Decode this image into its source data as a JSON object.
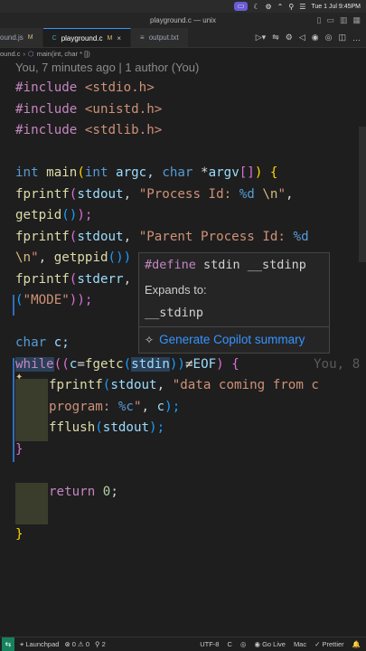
{
  "menubar": {
    "items": [
      "▭",
      "☾",
      "⚙",
      "⌃",
      "⚲",
      "☰"
    ],
    "datetime": "Tue 1 Jul  9:45PM"
  },
  "window": {
    "title": "playground.c — unix"
  },
  "tabs": [
    {
      "label": "ound.js",
      "modified": "M",
      "active": false
    },
    {
      "label": "playground.c",
      "modified": "M",
      "active": true,
      "close": "×"
    },
    {
      "label": "output.txt",
      "active": false
    }
  ],
  "breadcrumb": {
    "file": "ound.c",
    "sep": "›",
    "symbol": "main(int, char * [])"
  },
  "blame": "You, 7 minutes ago | 1 author (You)",
  "code": {
    "inc1": {
      "kw": "#include",
      "hdr": " <stdio.h>"
    },
    "inc2": {
      "kw": "#include",
      "hdr": " <unistd.h>"
    },
    "inc3": {
      "kw": "#include",
      "hdr": " <stdlib.h>"
    },
    "main": {
      "t1": "int",
      "name": " main",
      "p1": "(",
      "t2": "int",
      "a1": " argc, ",
      "t3": "char",
      "a2": " *",
      "a3": "argv",
      "a4": "[]",
      "p2": ")",
      "brace": " {"
    },
    "pf1": {
      "fn": "fprintf",
      "p": "(",
      "v": "stdout",
      "c": ", ",
      "s": "\"Process Id: ",
      "f": "%d",
      "e": " \\n",
      "q": "\"",
      "end": ","
    },
    "pf1b": {
      "fn": "getpid",
      "p": "()",
      "end": ");"
    },
    "pf2": {
      "fn": "fprintf",
      "p": "(",
      "v": "stdout",
      "c": ", ",
      "s": "\"Parent Process Id: ",
      "f": "%d"
    },
    "pf2b": {
      "e": "\\n",
      "q": "\"",
      "c": ", ",
      "fn": "getppid",
      "p": "())"
    },
    "pf3": {
      "fn": "fprintf",
      "p": "(",
      "v": "stderr",
      "c": ","
    },
    "pf3b": {
      "p": "(",
      "s": "\"MODE\"",
      "end": "));"
    },
    "charc": {
      "t": "char",
      "v": " c;"
    },
    "while": {
      "kw": "while",
      "p1": "((",
      "v": "c",
      "eq": "=",
      "fn": "fgetc",
      "p2": "(",
      "arg": "stdin",
      "p3": "))",
      "ne": "≠",
      "eof": "EOF",
      "p4": ")",
      "brace": " {",
      "ghost": "You, 8"
    },
    "inner1": {
      "fn": "fprintf",
      "p": "(",
      "v": "stdout",
      "c": ", ",
      "s": "\"data coming from c"
    },
    "inner2": {
      "s": "program: ",
      "f": "%c",
      "q": "\"",
      "c": ", ",
      "v": "c",
      "end": ");"
    },
    "inner3": {
      "fn": "fflush",
      "p": "(",
      "v": "stdout",
      "end": ");"
    },
    "close1": "}",
    "ret": {
      "kw": "return",
      "n": " 0",
      "end": ";"
    },
    "close2": "}"
  },
  "hover": {
    "define_kw": "#define",
    "define_rest": " stdin __stdinp",
    "expands_label": "Expands to:",
    "expands_value": "__stdinp",
    "action_icon": "✧",
    "action_label": "Generate Copilot summary"
  },
  "statusbar": {
    "remote_icon": "⇆",
    "launchpad": "Launchpad",
    "problems": "⊗ 0 ⚠ 0",
    "ports": "2",
    "encoding": "UTF-8",
    "language": "C",
    "golive": "Go Live",
    "platform": "Mac",
    "prettier": "✓ Prettier"
  }
}
